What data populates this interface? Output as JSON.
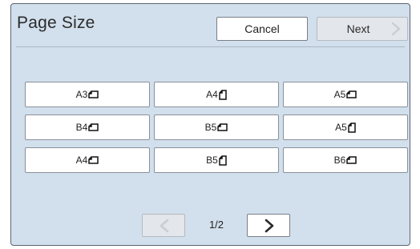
{
  "dialog": {
    "title": "Page Size",
    "cancel_label": "Cancel",
    "next_label": "Next"
  },
  "sizes": [
    {
      "label": "A3",
      "orientation": "landscape"
    },
    {
      "label": "A4",
      "orientation": "portrait"
    },
    {
      "label": "A5",
      "orientation": "landscape"
    },
    {
      "label": "B4",
      "orientation": "landscape"
    },
    {
      "label": "B5",
      "orientation": "landscape"
    },
    {
      "label": "A5",
      "orientation": "portrait"
    },
    {
      "label": "A4",
      "orientation": "landscape"
    },
    {
      "label": "B5",
      "orientation": "portrait"
    },
    {
      "label": "B6",
      "orientation": "landscape"
    }
  ],
  "pagination": {
    "indicator": "1/2"
  },
  "colors": {
    "panel_bg": "#d2dfec",
    "button_bg": "#ffffff",
    "disabled_bg": "#e3e6ea",
    "disabled_chevron": "#c9ced5",
    "active_chevron": "#2a2a2a"
  }
}
